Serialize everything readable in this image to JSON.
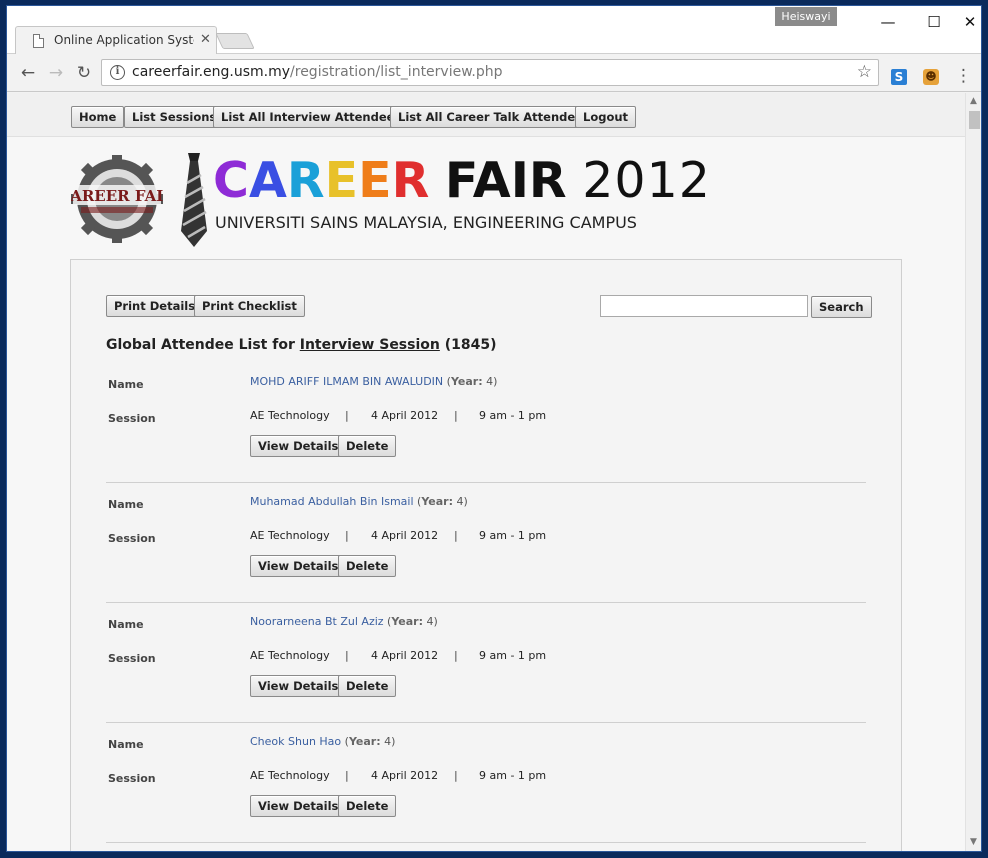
{
  "browser": {
    "tab_title": "Online Application Syster",
    "tab_close": "✕",
    "user_badge": "Heiswayi",
    "window_min": "—",
    "window_max": "☐",
    "window_close": "✕",
    "url_domain": "careerfair.eng.usm.my",
    "url_path": "/registration/list_interview.php"
  },
  "nav": {
    "home": "Home",
    "list_sessions": "List Sessions",
    "list_interview": "List All Interview Attendees",
    "list_career_talk": "List All Career Talk Attendees",
    "logout": "Logout"
  },
  "banner": {
    "logo_top": "CAREER FAIR",
    "brand_letters": [
      "C",
      "A",
      "R",
      "E",
      "E",
      "R"
    ],
    "brand_fair": "FAIR",
    "brand_year": "2012",
    "subtitle": "UNIVERSITI SAINS MALAYSIA, ENGINEERING CAMPUS"
  },
  "actions": {
    "print_details": "Print Details",
    "print_checklist": "Print Checklist",
    "search": "Search"
  },
  "list": {
    "heading_prefix": "Global Attendee List for",
    "heading_link": "Interview Session",
    "heading_count": "(1845)",
    "name_label": "Name",
    "session_label": "Session",
    "year_label": "Year:",
    "view_details": "View Details",
    "delete": "Delete",
    "separator": "|",
    "entries": [
      {
        "name": "MOHD ARIFF ILMAM BIN AWALUDIN",
        "year": "4",
        "company": "AE Technology",
        "date": "4 April 2012",
        "time": "9 am - 1 pm"
      },
      {
        "name": "Muhamad Abdullah Bin Ismail",
        "year": "4",
        "company": "AE Technology",
        "date": "4 April 2012",
        "time": "9 am - 1 pm"
      },
      {
        "name": "Noorarneena Bt Zul Aziz",
        "year": "4",
        "company": "AE Technology",
        "date": "4 April 2012",
        "time": "9 am - 1 pm"
      },
      {
        "name": "Cheok Shun Hao",
        "year": "4",
        "company": "AE Technology",
        "date": "4 April 2012",
        "time": "9 am - 1 pm"
      }
    ]
  },
  "icons": {
    "back": "arrow-left-icon",
    "forward": "arrow-right-icon",
    "reload": "reload-icon",
    "info": "info-icon",
    "star": "star-icon",
    "menu": "menu-dots-icon"
  }
}
